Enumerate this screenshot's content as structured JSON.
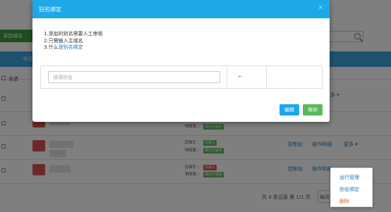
{
  "background": {
    "add_button_label": "添加域名",
    "table_header_label": "今日",
    "select_all_label": "全选",
    "row_labels": {
      "dns": "DNS :",
      "web": "WEB :"
    },
    "tags": {
      "green": "域名已解析",
      "not_resolved": "未接入"
    },
    "row_links": {
      "console": "控制台",
      "manage": "操作明细",
      "more": "更多 ▾"
    },
    "pagination_text": "共 4 条记录 第 1/1 页",
    "page_size": "每页"
  },
  "dropdown": {
    "items": [
      "运行管理",
      "别名绑定",
      "删除"
    ]
  },
  "modal": {
    "title": "别名绑定",
    "close": "×",
    "tips": {
      "line1": "1.添加的别名需要人工审核",
      "line2": "2.只需输入主域名",
      "line3_prefix": "3.什么",
      "line3_link": "是别名绑定"
    },
    "input_placeholder": "请填别名",
    "dash": "–",
    "edit_label": "编辑",
    "save_label": "保存"
  },
  "colors": {
    "modal_header": "#1da8e8",
    "save_button": "#5cb85c",
    "edit_button": "#1da8e8",
    "overlay": "rgba(0,0,0,0.5)"
  }
}
